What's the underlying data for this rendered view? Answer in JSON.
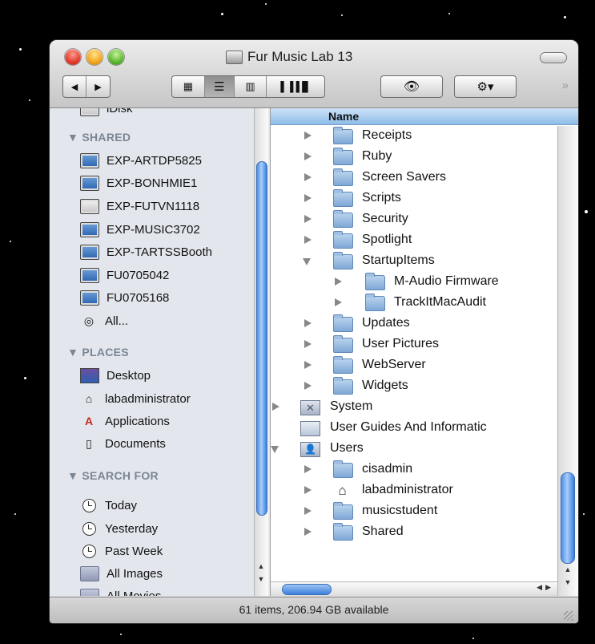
{
  "window": {
    "title": "Fur Music Lab 13"
  },
  "toolbar": {
    "back_icon": "back-arrow-icon",
    "forward_icon": "forward-arrow-icon",
    "view_modes": [
      "icon-view",
      "list-view",
      "column-view",
      "coverflow-view"
    ],
    "active_view": "list-view",
    "quicklook_icon": "eye-icon",
    "action_icon": "gear-icon",
    "overflow_icon": "double-chevron-icon"
  },
  "sidebar": {
    "partial_top_item": "iDisk",
    "shared_header": "SHARED",
    "shared": [
      "EXP-ARTDP5825",
      "EXP-BONHMIE1",
      "EXP-FUTVN1118",
      "EXP-MUSIC3702",
      "EXP-TARTSSBooth",
      "FU0705042",
      "FU0705168",
      "All..."
    ],
    "places_header": "PLACES",
    "places": [
      "Desktop",
      "labadministrator",
      "Applications",
      "Documents"
    ],
    "search_header": "SEARCH FOR",
    "search": [
      "Today",
      "Yesterday",
      "Past Week",
      "All Images",
      "All Movies"
    ]
  },
  "list": {
    "column_header": "Name",
    "rows": [
      {
        "name": "Receipts"
      },
      {
        "name": "Ruby"
      },
      {
        "name": "Screen Savers"
      },
      {
        "name": "Scripts"
      },
      {
        "name": "Security"
      },
      {
        "name": "Spotlight"
      },
      {
        "name": "StartupItems"
      },
      {
        "name": "M-Audio Firmware"
      },
      {
        "name": "TrackItMacAudit"
      },
      {
        "name": "Updates"
      },
      {
        "name": "User Pictures"
      },
      {
        "name": "WebServer"
      },
      {
        "name": "Widgets"
      },
      {
        "name": "System"
      },
      {
        "name": "User Guides And Informatic"
      },
      {
        "name": "Users"
      },
      {
        "name": "cisadmin"
      },
      {
        "name": "labadministrator"
      },
      {
        "name": "musicstudent"
      },
      {
        "name": "Shared"
      }
    ]
  },
  "status": {
    "text": "61 items, 206.94 GB available"
  },
  "colors": {
    "selection_blue": "#3a7ede",
    "sidebar_bg": "#e3e7ed",
    "header_blue": "#8ebde9"
  }
}
